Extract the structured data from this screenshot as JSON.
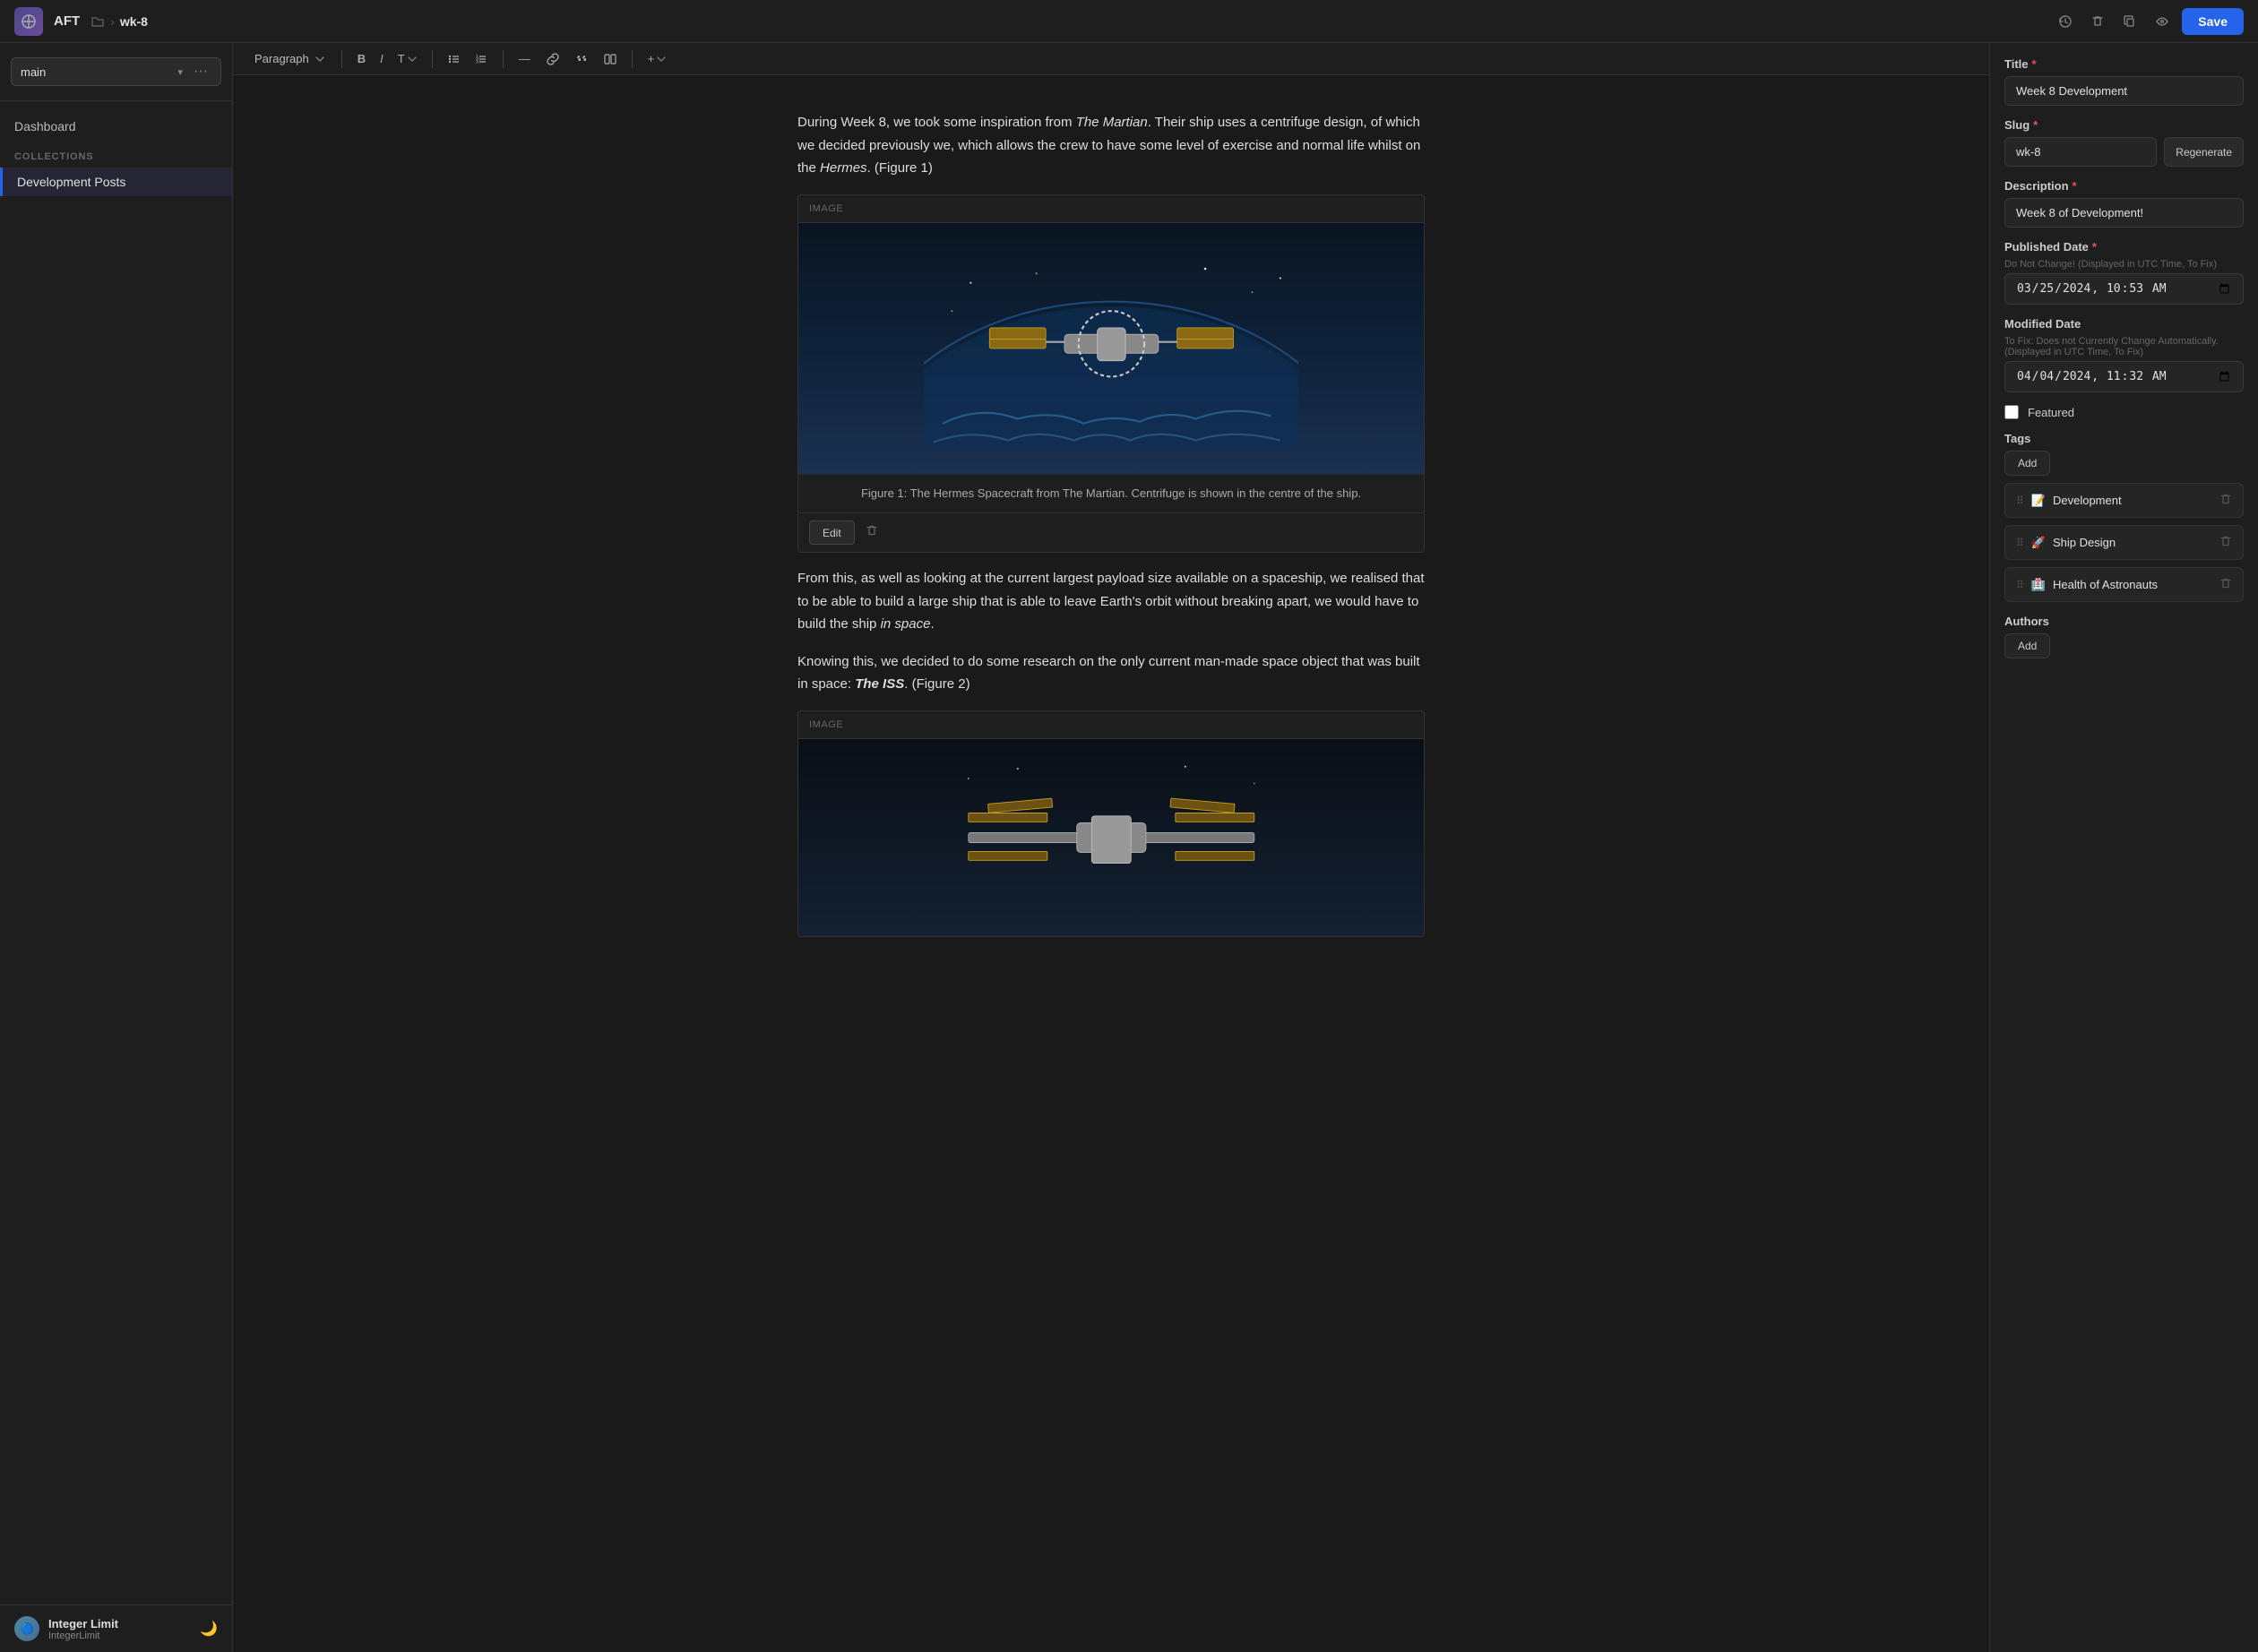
{
  "topbar": {
    "app_name": "AFT",
    "breadcrumb_separator": ">",
    "breadcrumb_current": "wk-8",
    "save_label": "Save"
  },
  "sidebar": {
    "branch": "main",
    "dashboard_label": "Dashboard",
    "collections_label": "COLLECTIONS",
    "nav_items": [
      {
        "id": "development-posts",
        "label": "Development Posts",
        "active": true
      }
    ],
    "user": {
      "name": "Integer Limit",
      "handle": "IntegerLimit"
    }
  },
  "toolbar": {
    "paragraph_label": "Paragraph",
    "bold": "B",
    "italic": "I",
    "text_size": "T",
    "bullet_list": "≡",
    "ordered_list": "≡",
    "divider": "—",
    "link": "🔗",
    "quote": "❝",
    "columns": "⊞",
    "add": "+"
  },
  "editor": {
    "para1": "During Week 8, we took some inspiration from The Martian. Their ship uses a centrifuge design, of which we decided previously we, which allows the crew to have some level of exercise and normal life whilst on the Hermes. (Figure 1)",
    "image1_label": "IMAGE",
    "image1_caption": "Figure 1: The Hermes Spacecraft from The Martian. Centrifuge is shown in the centre of the ship.",
    "edit_btn": "Edit",
    "para2": "From this, as well as looking at the current largest payload size available on a spaceship, we realised that to be able to build a large ship that is able to leave Earth's orbit without breaking apart, we would have to build the ship in space.",
    "para3": "Knowing this, we decided to do some research on the only current man-made space object that was built in space: The ISS. (Figure 2)",
    "image2_label": "IMAGE"
  },
  "right_panel": {
    "title_label": "Title",
    "title_value": "Week 8 Development",
    "slug_label": "Slug",
    "slug_value": "wk-8",
    "regenerate_label": "Regenerate",
    "description_label": "Description",
    "description_value": "Week 8 of Development!",
    "published_date_label": "Published Date",
    "published_date_hint": "Do Not Change! (Displayed in UTC Time, To Fix)",
    "published_date_value": "2024-03-25T10:53",
    "modified_date_label": "Modified Date",
    "modified_date_hint": "To Fix: Does not Currently Change Automatically. (Displayed in UTC Time, To Fix)",
    "modified_date_value": "2024-04-04T11:32",
    "featured_label": "Featured",
    "tags_label": "Tags",
    "add_tag_label": "Add",
    "tags": [
      {
        "emoji": "📝",
        "label": "Development"
      },
      {
        "emoji": "🚀",
        "label": "Ship Design"
      },
      {
        "emoji": "🏥",
        "label": "Health of Astronauts"
      }
    ],
    "authors_label": "Authors",
    "add_author_label": "Add"
  }
}
